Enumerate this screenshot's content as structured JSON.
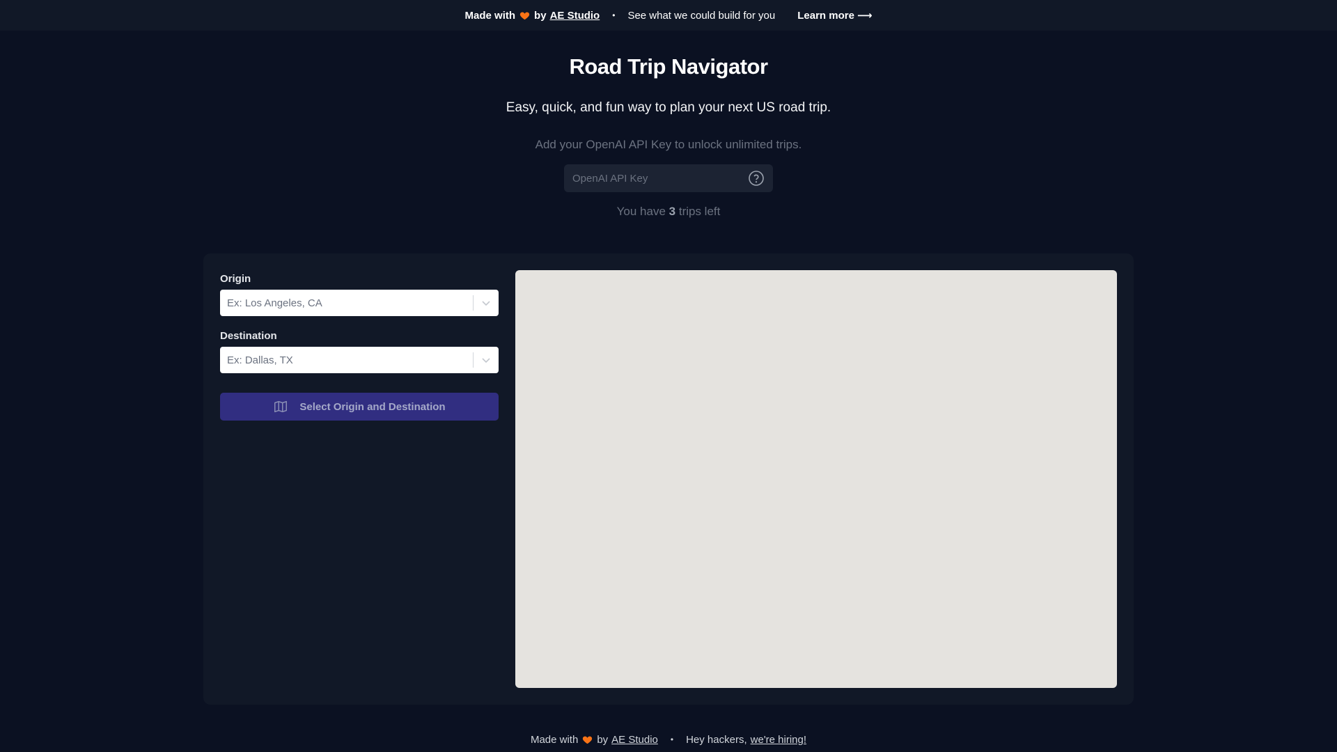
{
  "banner": {
    "made_with": "Made with",
    "by": "by",
    "studio_link": "AE Studio",
    "separator": "•",
    "pitch": "See what we could build for you",
    "learn_more": "Learn more",
    "arrow": "⟶"
  },
  "header": {
    "title": "Road Trip Navigator",
    "subtitle": "Easy, quick, and fun way to plan your next US road trip.",
    "api_hint": "Add your OpenAI API Key to unlock unlimited trips.",
    "api_placeholder": "OpenAI API Key",
    "trips_prefix": "You have",
    "trips_count": "3",
    "trips_suffix": "trips left"
  },
  "form": {
    "origin_label": "Origin",
    "origin_placeholder": "Ex: Los Angeles, CA",
    "destination_label": "Destination",
    "destination_placeholder": "Ex: Dallas, TX",
    "submit_label": "Select Origin and Destination"
  },
  "footer": {
    "made_with": "Made with",
    "by": "by",
    "studio_link": "AE Studio",
    "separator": "•",
    "hackers": "Hey hackers,",
    "hiring_link": "we're hiring!"
  },
  "colors": {
    "background": "#0b1122",
    "panel": "#111827",
    "accent_button": "#312e81",
    "heart": "#f97316",
    "map": "#e5e3df"
  },
  "icons": [
    "heart-icon",
    "help-circle-icon",
    "chevron-down-icon",
    "map-icon",
    "arrow-right-icon"
  ]
}
